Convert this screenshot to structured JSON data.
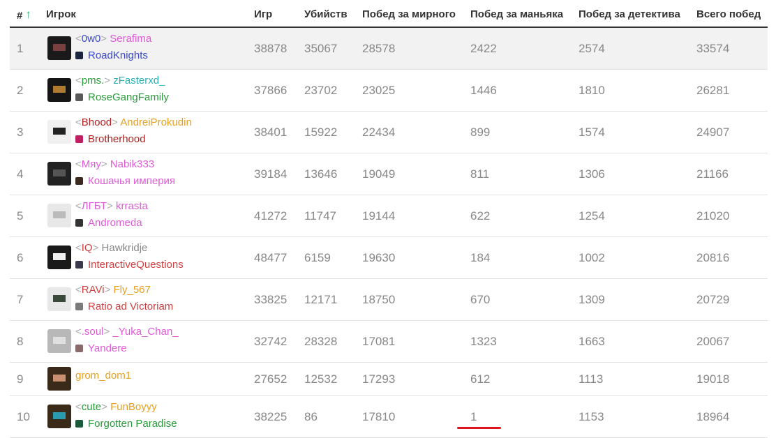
{
  "header": {
    "rank": "#",
    "player": "Игрок",
    "games": "Игр",
    "kills": "Убийств",
    "wins_innocent": "Побед за мирного",
    "wins_murderer": "Побед за маньяка",
    "wins_detective": "Побед за детектива",
    "wins_total": "Всего побед",
    "sort_icon": "arrow-up-icon",
    "sort_color": "#3cb371"
  },
  "colors": {
    "highlight_underline": "#e0141e"
  },
  "rows": [
    {
      "rank": "1",
      "tag": "0w0",
      "tag_color": "#3a48c9",
      "name": "Serafima",
      "name_color": "#e05ad8",
      "guild": "RoadKnights",
      "guild_color": "#3a48c9",
      "guild_icon": "#1c2540",
      "avatar_base": "#1a1a1a",
      "avatar_face": "#7a4040",
      "games": "38878",
      "kills": "35067",
      "wins_innocent": "28578",
      "wins_murderer": "2422",
      "wins_detective": "2574",
      "wins_total": "33574"
    },
    {
      "rank": "2",
      "tag": "pms.",
      "tag_color": "#2a9a3a",
      "name": "zFasterxd_",
      "name_color": "#2ab0b0",
      "guild": "RoseGangFamily",
      "guild_color": "#2a9a3a",
      "guild_icon": "#5a5a5a",
      "avatar_base": "#151515",
      "avatar_face": "#b07a30",
      "games": "37866",
      "kills": "23702",
      "wins_innocent": "23025",
      "wins_murderer": "1446",
      "wins_detective": "1810",
      "wins_total": "26281"
    },
    {
      "rank": "3",
      "tag": "Bhood",
      "tag_color": "#b02020",
      "name": "AndreiProkudin",
      "name_color": "#e8a020",
      "guild": "Brotherhood",
      "guild_color": "#b02020",
      "guild_icon": "#c02060",
      "avatar_base": "#f0f0f0",
      "avatar_face": "#222222",
      "games": "38401",
      "kills": "15922",
      "wins_innocent": "22434",
      "wins_murderer": "899",
      "wins_detective": "1574",
      "wins_total": "24907"
    },
    {
      "rank": "4",
      "tag": "Мяу",
      "tag_color": "#e05ad8",
      "name": "Nabik333",
      "name_color": "#e05ad8",
      "guild": "Кошачья империя",
      "guild_color": "#e05ad8",
      "guild_icon": "#3a2a20",
      "avatar_base": "#222222",
      "avatar_face": "#555555",
      "games": "39184",
      "kills": "13646",
      "wins_innocent": "19049",
      "wins_murderer": "811",
      "wins_detective": "1306",
      "wins_total": "21166"
    },
    {
      "rank": "5",
      "tag": "ЛГБТ",
      "tag_color": "#e05ad8",
      "name": "krrasta",
      "name_color": "#e05ad8",
      "guild": "Andromeda",
      "guild_color": "#e05ad8",
      "guild_icon": "#333333",
      "avatar_base": "#e8e8e8",
      "avatar_face": "#bbbbbb",
      "games": "41272",
      "kills": "11747",
      "wins_innocent": "19144",
      "wins_murderer": "622",
      "wins_detective": "1254",
      "wins_total": "21020"
    },
    {
      "rank": "6",
      "tag": "IQ",
      "tag_color": "#d04040",
      "name": "Hawkridje",
      "name_color": "#888888",
      "guild": "InteractiveQuestions",
      "guild_color": "#d04040",
      "guild_icon": "#3a3a4a",
      "avatar_base": "#1a1a1a",
      "avatar_face": "#f0f0f0",
      "games": "48477",
      "kills": "6159",
      "wins_innocent": "19630",
      "wins_murderer": "184",
      "wins_detective": "1002",
      "wins_total": "20816"
    },
    {
      "rank": "7",
      "tag": "RAVi",
      "tag_color": "#d04040",
      "name": "Fly_567",
      "name_color": "#e8a020",
      "guild": "Ratio ad Victoriam",
      "guild_color": "#d04040",
      "guild_icon": "#7a7a7a",
      "avatar_base": "#e8e8e8",
      "avatar_face": "#3a4a3a",
      "games": "33825",
      "kills": "12171",
      "wins_innocent": "18750",
      "wins_murderer": "670",
      "wins_detective": "1309",
      "wins_total": "20729"
    },
    {
      "rank": "8",
      "tag": ".soul",
      "tag_color": "#e05ad8",
      "name": "_Yuka_Chan_",
      "name_color": "#e05ad8",
      "guild": "Yandere",
      "guild_color": "#e05ad8",
      "guild_icon": "#8a6a6a",
      "avatar_base": "#b8b8b8",
      "avatar_face": "#e0e0e0",
      "games": "32742",
      "kills": "28328",
      "wins_innocent": "17081",
      "wins_murderer": "1323",
      "wins_detective": "1663",
      "wins_total": "20067"
    },
    {
      "rank": "9",
      "tag": "",
      "tag_color": "",
      "name": "grom_dom1",
      "name_color": "#e8a020",
      "guild": "",
      "guild_color": "",
      "guild_icon": "",
      "avatar_base": "#3a2a1a",
      "avatar_face": "#c89070",
      "games": "27652",
      "kills": "12532",
      "wins_innocent": "17293",
      "wins_murderer": "612",
      "wins_detective": "1113",
      "wins_total": "19018"
    },
    {
      "rank": "10",
      "tag": "cute",
      "tag_color": "#2a9a3a",
      "name": "FunBoyyy",
      "name_color": "#e8a020",
      "guild": "Forgotten Paradise",
      "guild_color": "#2a9a3a",
      "guild_icon": "#1a5a3a",
      "avatar_base": "#3a2a1a",
      "avatar_face": "#2a9ab0",
      "games": "38225",
      "kills": "86",
      "wins_innocent": "17810",
      "wins_murderer": "1",
      "wins_detective": "1153",
      "wins_total": "18964"
    }
  ]
}
